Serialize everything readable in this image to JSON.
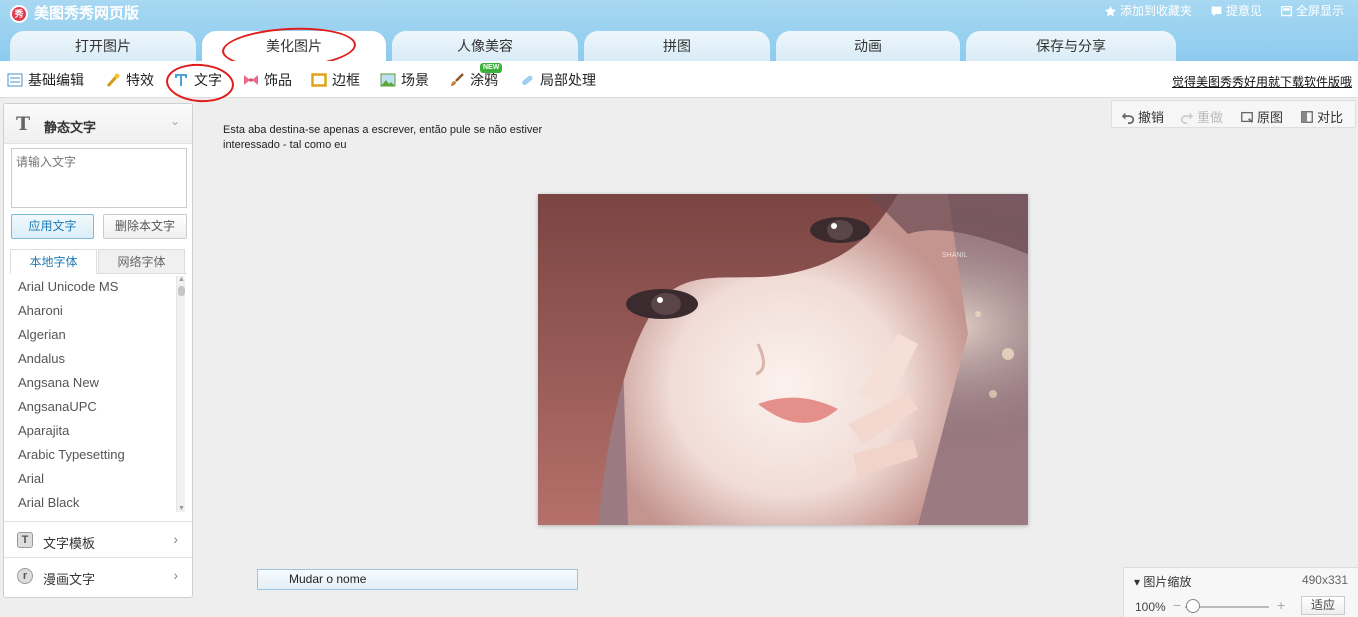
{
  "app": {
    "title": "美图秀秀网页版",
    "logo_text": "秀"
  },
  "top_links": [
    {
      "label": "添加到收藏夹",
      "icon": "star-icon"
    },
    {
      "label": "提意见",
      "icon": "comment-icon"
    },
    {
      "label": "全屏显示",
      "icon": "fullscreen-icon"
    }
  ],
  "tabs": [
    "打开图片",
    "美化图片",
    "人像美容",
    "拼图",
    "动画",
    "保存与分享"
  ],
  "active_tab": "美化图片",
  "toolbar": {
    "items": [
      "基础编辑",
      "特效",
      "文字",
      "饰品",
      "边框",
      "场景",
      "涂鸦",
      "局部处理"
    ],
    "new_badge": "NEW",
    "promo_link": "觉得美图秀秀好用就下载软件版哦"
  },
  "sidebar": {
    "title": "静态文字",
    "text_placeholder": "请输入文字",
    "apply_button": "应用文字",
    "delete_button": "删除本文字",
    "font_tabs": [
      "本地字体",
      "网络字体"
    ],
    "fonts": [
      "Arial Unicode MS",
      "Aharoni",
      "Algerian",
      "Andalus",
      "Angsana New",
      "AngsanaUPC",
      "Aparajita",
      "Arabic Typesetting",
      "Arial",
      "Arial Black"
    ],
    "sections": [
      "文字模板",
      "漫画文字"
    ]
  },
  "annotation_note": "Esta aba destina-se apenas a escrever, então pule se não estiver interessado - tal como eu",
  "image_actions": [
    {
      "label": "撤销",
      "enabled": true
    },
    {
      "label": "重做",
      "enabled": false
    },
    {
      "label": "原图",
      "enabled": true
    },
    {
      "label": "对比",
      "enabled": true
    }
  ],
  "rename_label": "Mudar o nome",
  "photo_watermark": "SHANIL",
  "zoom": {
    "title": "图片缩放",
    "size": "490x331",
    "percent": "100%",
    "level": 1.0,
    "fit_button": "适应"
  },
  "colors": {
    "header": "#9fd4f0",
    "annotation": "#e11c1c",
    "accent": "#1f7bb3"
  }
}
